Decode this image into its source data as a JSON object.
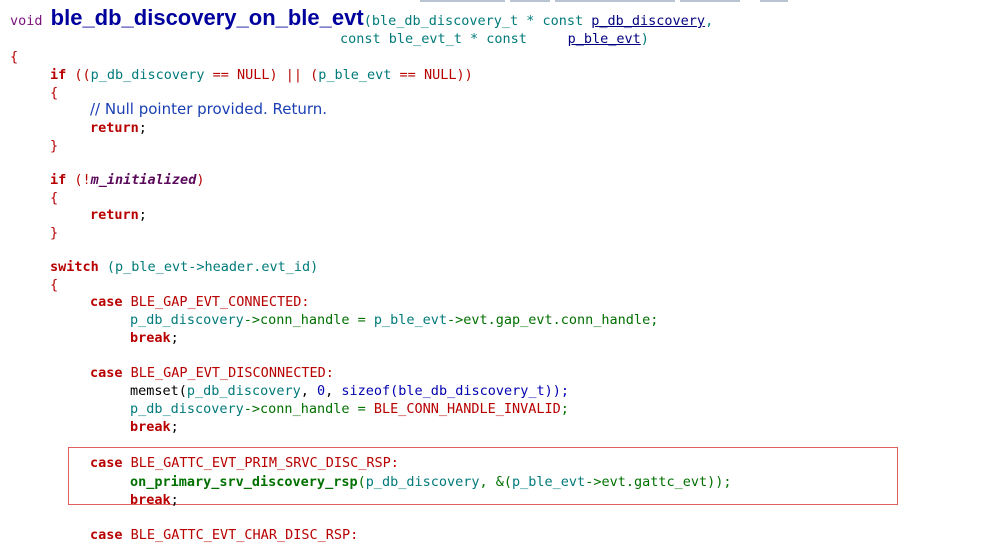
{
  "sig": {
    "ret": "void",
    "name": "ble_db_discovery_on_ble_evt",
    "p1_open": "(ble_db_discovery_t * const ",
    "p1_name": "p_db_discovery",
    "p1_tail": ",",
    "p2_type": "const ble_evt_t * const     ",
    "p2_name": "p_ble_evt",
    "p2_tail": ")"
  },
  "code": {
    "brace_open": "{",
    "brace_close": "}",
    "if1": {
      "kw": "if",
      "a": " ((",
      "b": "p_db_discovery",
      "c": " == ",
      "d": "NULL",
      "e": ") || (",
      "f": "p_ble_evt",
      "g": " == ",
      "h": "NULL",
      "i": "))"
    },
    "comment": "// Null pointer provided. Return.",
    "ret": "return",
    "semi": ";",
    "if2": {
      "kw": "if",
      "a": " (!",
      "b": "m_initialized",
      "c": ")"
    },
    "sw": {
      "kw": "switch",
      "a": " (",
      "b": "p_ble_evt->header.evt_id",
      "c": ")"
    },
    "case": "case",
    "brk": "break",
    "c1": {
      "label": " BLE_GAP_EVT_CONNECTED:",
      "s1a": "p_db_discovery",
      "s1b": "->conn_handle = ",
      "s1c": "p_ble_evt",
      "s1d": "->evt.gap_evt.conn_handle;"
    },
    "c2": {
      "label": " BLE_GAP_EVT_DISCONNECTED:",
      "m1": "memset",
      "m2": "(",
      "m3": "p_db_discovery",
      "m4": ", ",
      "m5": "0",
      "m6": ", ",
      "m7": "sizeof",
      "m8": "(ble_db_discovery_t));",
      "s1a": "p_db_discovery",
      "s1b": "->conn_handle = ",
      "s1c": "BLE_CONN_HANDLE_INVALID",
      "s1d": ";"
    },
    "c3": {
      "label": " BLE_GATTC_EVT_PRIM_SRVC_DISC_RSP:",
      "f1": "on_primary_srv_discovery_rsp",
      "f2": "(",
      "f3": "p_db_discovery",
      "f4": ", &(",
      "f5": "p_ble_evt",
      "f6": "->evt.gattc_evt));"
    },
    "c4": {
      "label": " BLE_GATTC_EVT_CHAR_DISC_RSP:"
    }
  }
}
